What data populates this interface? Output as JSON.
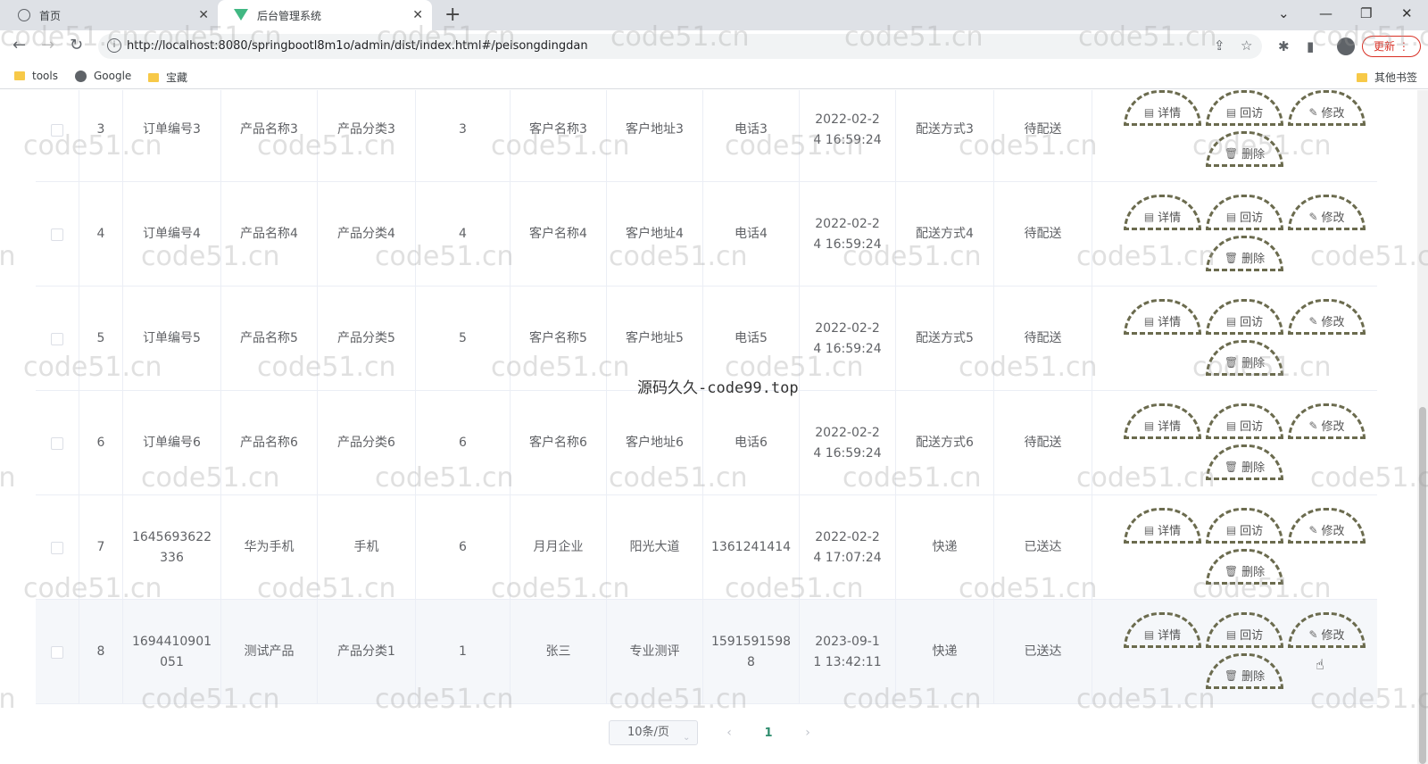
{
  "browser": {
    "tabs": [
      {
        "title": "首页",
        "active": false
      },
      {
        "title": "后台管理系统",
        "active": true
      }
    ],
    "url": "http://localhost:8080/springbootl8m1o/admin/dist/index.html#/peisongdingdan",
    "update_label": "更新",
    "bookmarks": [
      "tools",
      "Google",
      "宝藏"
    ],
    "other_bookmarks": "其他书签"
  },
  "table": {
    "rows": [
      {
        "index": "3",
        "order_no": "订单编号3",
        "product_name": "产品名称3",
        "category": "产品分类3",
        "qty": "3",
        "customer": "客户名称3",
        "address": "客户地址3",
        "phone": "电话3",
        "time": "2022-02-24 16:59:24",
        "delivery": "配送方式3",
        "status": "待配送"
      },
      {
        "index": "4",
        "order_no": "订单编号4",
        "product_name": "产品名称4",
        "category": "产品分类4",
        "qty": "4",
        "customer": "客户名称4",
        "address": "客户地址4",
        "phone": "电话4",
        "time": "2022-02-24 16:59:24",
        "delivery": "配送方式4",
        "status": "待配送"
      },
      {
        "index": "5",
        "order_no": "订单编号5",
        "product_name": "产品名称5",
        "category": "产品分类5",
        "qty": "5",
        "customer": "客户名称5",
        "address": "客户地址5",
        "phone": "电话5",
        "time": "2022-02-24 16:59:24",
        "delivery": "配送方式5",
        "status": "待配送"
      },
      {
        "index": "6",
        "order_no": "订单编号6",
        "product_name": "产品名称6",
        "category": "产品分类6",
        "qty": "6",
        "customer": "客户名称6",
        "address": "客户地址6",
        "phone": "电话6",
        "time": "2022-02-24 16:59:24",
        "delivery": "配送方式6",
        "status": "待配送"
      },
      {
        "index": "7",
        "order_no": "1645693622336",
        "product_name": "华为手机",
        "category": "手机",
        "qty": "6",
        "customer": "月月企业",
        "address": "阳光大道",
        "phone": "1361241414",
        "time": "2022-02-24 17:07:24",
        "delivery": "快递",
        "status": "已送达"
      },
      {
        "index": "8",
        "order_no": "1694410901051",
        "product_name": "测试产品",
        "category": "产品分类1",
        "qty": "1",
        "customer": "张三",
        "address": "专业测评",
        "phone": "15915915988",
        "time": "2023-09-11 13:42:11",
        "delivery": "快递",
        "status": "已送达"
      }
    ],
    "actions": {
      "detail": "详情",
      "revisit": "回访",
      "edit": "修改",
      "delete": "删除"
    }
  },
  "pagination": {
    "page_size": "10条/页",
    "current_page": "1"
  },
  "watermark": {
    "repeat_text": "code51.cn",
    "center_text": "源码久久-code99.top"
  }
}
